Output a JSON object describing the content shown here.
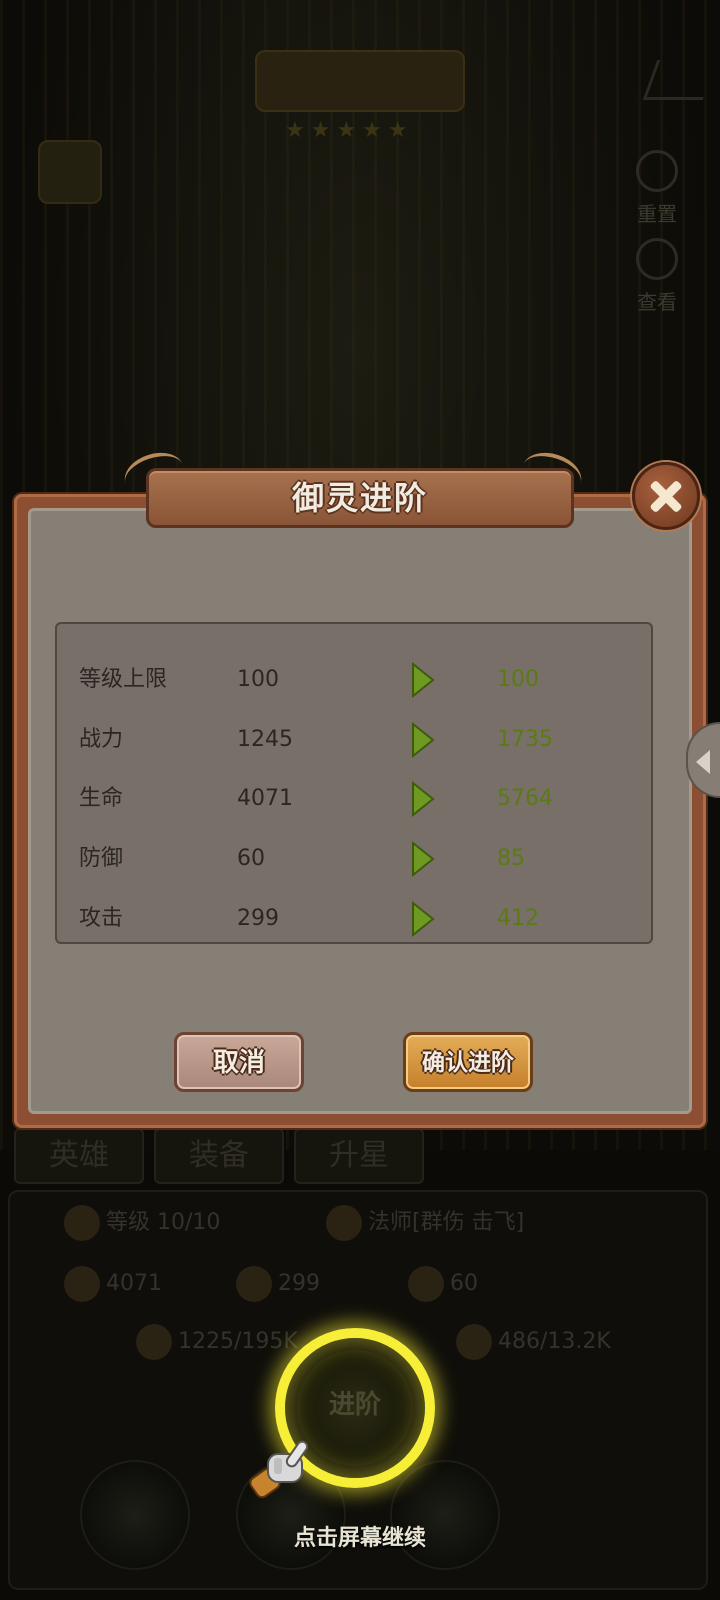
{
  "dialog": {
    "title": "御灵进阶",
    "close_icon": "close-icon",
    "stats": [
      {
        "label": "等级上限",
        "old": "100",
        "new": "100"
      },
      {
        "label": "战力",
        "old": "1245",
        "new": "1735"
      },
      {
        "label": "生命",
        "old": "4071",
        "new": "5764"
      },
      {
        "label": "防御",
        "old": "60",
        "new": "85"
      },
      {
        "label": "攻击",
        "old": "299",
        "new": "412"
      }
    ],
    "buttons": {
      "cancel": "取消",
      "confirm": "确认进阶"
    }
  },
  "tutorial": {
    "hint": "点击屏幕继续",
    "highlight_button": "进阶"
  },
  "background": {
    "tabs": [
      "英雄",
      "装备",
      "升星"
    ],
    "level": "等级 10/10",
    "class": "法师[群伤 击飞]",
    "hp": "4071",
    "atk": "299",
    "def": "60",
    "res1": "1225/195K",
    "res2": "486/13.2K",
    "side_buttons": [
      "重置",
      "查看"
    ]
  },
  "colors": {
    "modal_frame": "#8c4f33",
    "panel_bg": "#867f76",
    "new_value": "#5a7a12",
    "highlight": "#f7ef37",
    "confirm_button": "#d99440"
  }
}
